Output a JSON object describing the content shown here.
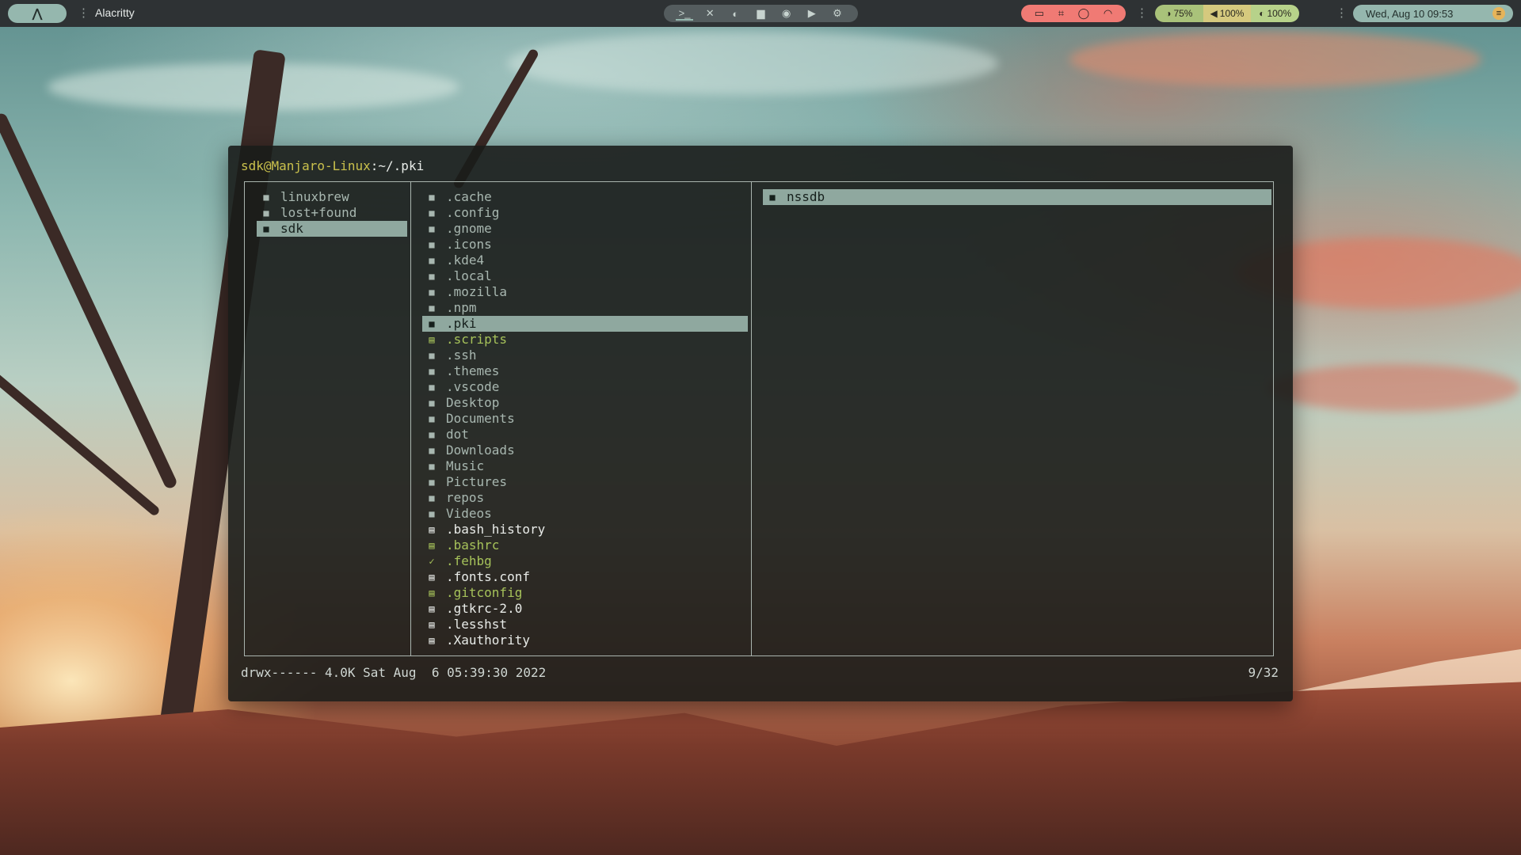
{
  "topbar": {
    "launcher_icon": "arch-logo-icon",
    "window_title": "Alacritty",
    "dock": [
      {
        "name": "terminal",
        "glyph": ">_"
      },
      {
        "name": "vscode",
        "glyph": "✕"
      },
      {
        "name": "firefox",
        "glyph": "◐"
      },
      {
        "name": "files",
        "glyph": "▆"
      },
      {
        "name": "spotify",
        "glyph": "◉"
      },
      {
        "name": "camera",
        "glyph": "▶"
      },
      {
        "name": "settings",
        "glyph": "⚙"
      }
    ],
    "tray_icons": [
      "monitor-icon",
      "crop-icon",
      "record-icon",
      "wifi-icon"
    ],
    "battery": "75%",
    "volume": "100%",
    "brightness": "100%",
    "clock": "Wed, Aug 10 09:53"
  },
  "terminal": {
    "prompt_user": "sdk@Manjaro-Linux",
    "prompt_sep": ":",
    "prompt_path": "~/.pki",
    "parent_pane": [
      {
        "name": "linuxbrew",
        "kind": "dir"
      },
      {
        "name": "lost+found",
        "kind": "dir"
      },
      {
        "name": "sdk",
        "kind": "dir",
        "selected": true
      }
    ],
    "current_pane": [
      {
        "name": ".cache",
        "kind": "dir"
      },
      {
        "name": ".config",
        "kind": "dir"
      },
      {
        "name": ".gnome",
        "kind": "dir"
      },
      {
        "name": ".icons",
        "kind": "dir"
      },
      {
        "name": ".kde4",
        "kind": "dir"
      },
      {
        "name": ".local",
        "kind": "dir"
      },
      {
        "name": ".mozilla",
        "kind": "dir"
      },
      {
        "name": ".npm",
        "kind": "dir"
      },
      {
        "name": ".pki",
        "kind": "dir",
        "selected": true
      },
      {
        "name": ".scripts",
        "kind": "exec"
      },
      {
        "name": ".ssh",
        "kind": "dir"
      },
      {
        "name": ".themes",
        "kind": "dir"
      },
      {
        "name": ".vscode",
        "kind": "dir"
      },
      {
        "name": "Desktop",
        "kind": "dir"
      },
      {
        "name": "Documents",
        "kind": "dir"
      },
      {
        "name": "dot",
        "kind": "dir"
      },
      {
        "name": "Downloads",
        "kind": "dir"
      },
      {
        "name": "Music",
        "kind": "dir"
      },
      {
        "name": "Pictures",
        "kind": "dir"
      },
      {
        "name": "repos",
        "kind": "dir"
      },
      {
        "name": "Videos",
        "kind": "dir"
      },
      {
        "name": ".bash_history",
        "kind": "file"
      },
      {
        "name": ".bashrc",
        "kind": "exec"
      },
      {
        "name": ".fehbg",
        "kind": "exec",
        "icon": "✓"
      },
      {
        "name": ".fonts.conf",
        "kind": "file"
      },
      {
        "name": ".gitconfig",
        "kind": "exec"
      },
      {
        "name": ".gtkrc-2.0",
        "kind": "file"
      },
      {
        "name": ".lesshst",
        "kind": "file"
      },
      {
        "name": ".Xauthority",
        "kind": "file"
      }
    ],
    "preview_pane": [
      {
        "name": "nssdb",
        "kind": "dir",
        "selected": true
      }
    ],
    "status_line": "drwx------ 4.0K Sat Aug  6 05:39:30 2022",
    "position": "9/32"
  },
  "colors": {
    "accent": "#95b7ae",
    "selection": "#8fa89f",
    "exec": "#a6c25a",
    "prompt_user": "#c9c04c",
    "tray_bg": "#f07a74"
  }
}
